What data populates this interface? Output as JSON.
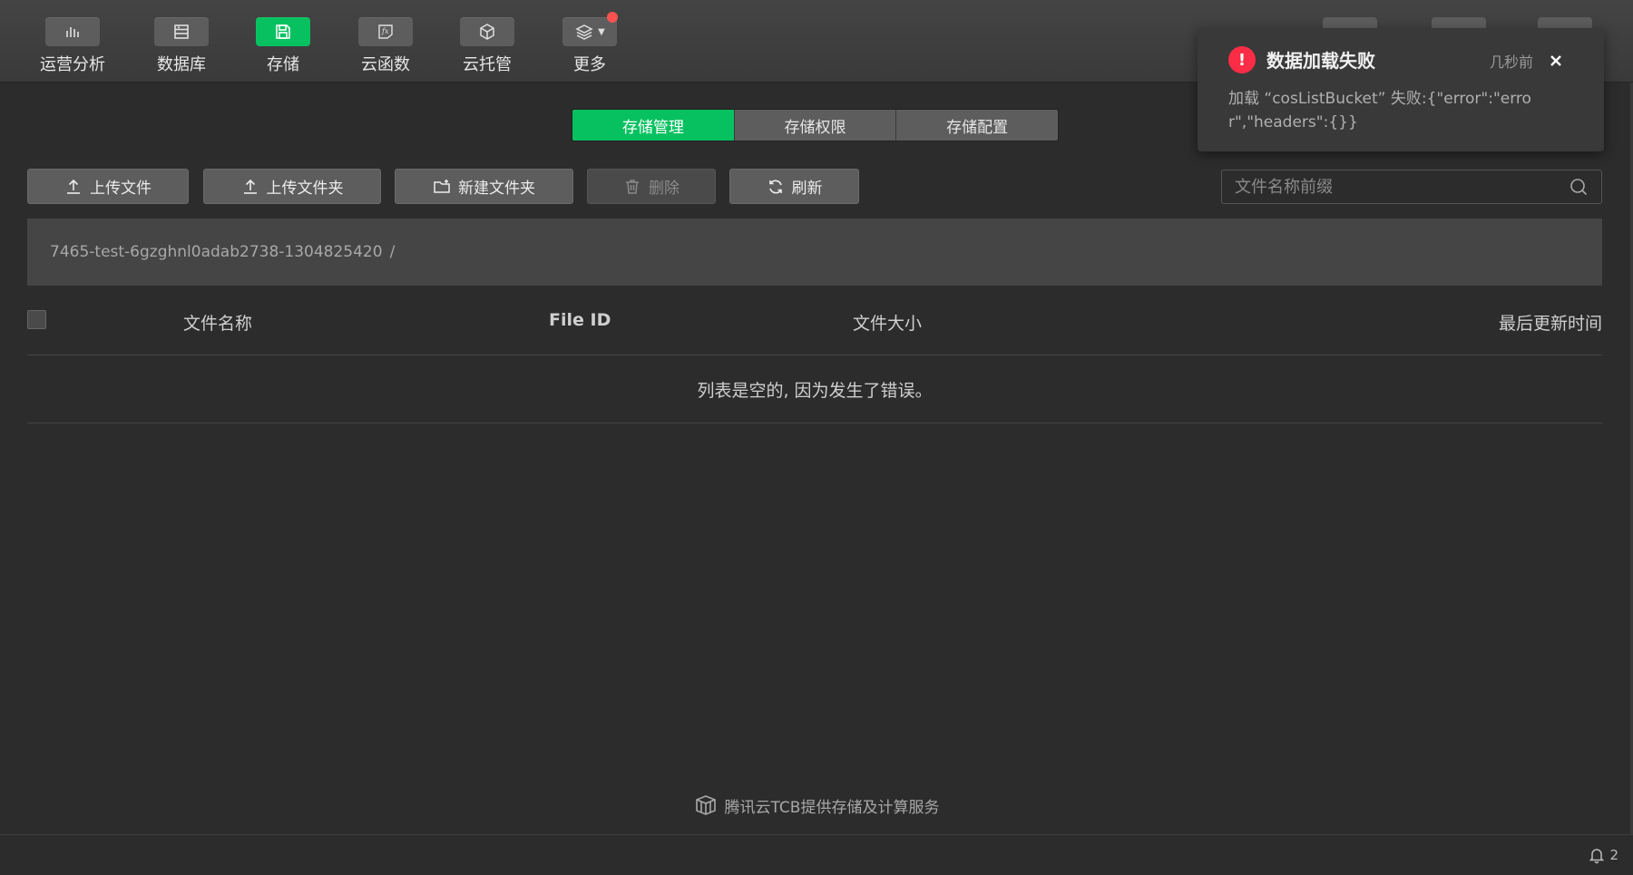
{
  "toolbar": {
    "items": [
      {
        "label": "运营分析",
        "icon": "bar-chart-icon"
      },
      {
        "label": "数据库",
        "icon": "database-icon"
      },
      {
        "label": "存储",
        "icon": "save-disk-icon",
        "active": true
      },
      {
        "label": "云函数",
        "icon": "function-fx-icon"
      },
      {
        "label": "云托管",
        "icon": "cube-icon"
      },
      {
        "label": "更多",
        "icon": "layers-icon"
      }
    ]
  },
  "tabs": {
    "items": [
      {
        "label": "存储管理",
        "active": true
      },
      {
        "label": "存储权限"
      },
      {
        "label": "存储配置"
      }
    ]
  },
  "actions": {
    "upload_file": "上传文件",
    "upload_folder": "上传文件夹",
    "new_folder": "新建文件夹",
    "delete": "删除",
    "refresh": "刷新"
  },
  "search": {
    "placeholder": "文件名称前缀"
  },
  "breadcrumb": {
    "path": "7465-test-6gzghnl0adab2738-1304825420",
    "separator": "/"
  },
  "table": {
    "columns": [
      "文件名称",
      "File ID",
      "文件大小",
      "最后更新时间"
    ],
    "empty_message": "列表是空的, 因为发生了错误。"
  },
  "footer": {
    "brand_text": "腾讯云TCB提供存储及计算服务"
  },
  "statusbar": {
    "notification_count": "2"
  },
  "toast": {
    "title": "数据加载失败",
    "time": "几秒前",
    "message": "加载 “cosListBucket” 失败:{\"error\":\"error\",\"headers\":{}}"
  },
  "colors": {
    "accent": "#07c160",
    "error": "#fa2c46",
    "background": "#2c2c2c"
  }
}
